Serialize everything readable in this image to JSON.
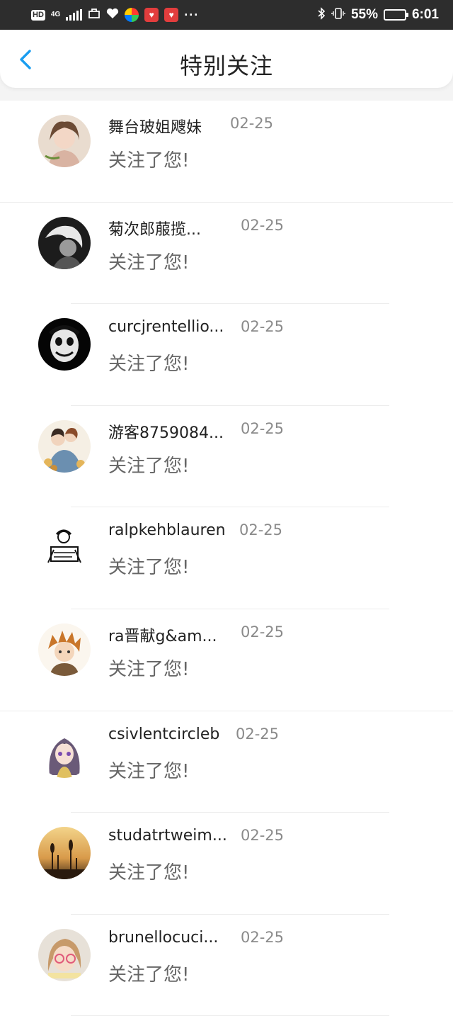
{
  "status_bar": {
    "hd_label": "HD",
    "network": "4G",
    "battery": "55%",
    "battery_level": 0.55,
    "time": "6:01",
    "more": "···",
    "icons": [
      "signal-icon",
      "bag-icon",
      "heart-icon",
      "multicolor-app-icon",
      "red-heart-app-icon",
      "red-heart-app-icon",
      "bluetooth-icon",
      "vibrate-icon",
      "battery-icon"
    ]
  },
  "header": {
    "title": "特别关注",
    "back_icon": "chevron-left-icon",
    "accent_color": "#1a9df0"
  },
  "notifications": [
    {
      "name": "舞台玻姐飕妹",
      "date": "02-25",
      "message": "关注了您!",
      "avatar": "avatar-girl-portrait"
    },
    {
      "name": "菊次郎菔揽...",
      "date": "02-25",
      "message": "关注了您!",
      "avatar": "avatar-bw-portrait"
    },
    {
      "name": "curcjrentellio...",
      "date": "02-25",
      "message": "关注了您!",
      "avatar": "avatar-clown-face"
    },
    {
      "name": "游客8759084...",
      "date": "02-25",
      "message": "关注了您!",
      "avatar": "avatar-couple-illustration"
    },
    {
      "name": "ralpkehblauren",
      "date": "02-25",
      "message": "关注了您!",
      "avatar": "avatar-sketch-logo"
    },
    {
      "name": "ra晋献g&am...",
      "date": "02-25",
      "message": "关注了您!",
      "avatar": "avatar-anime-boy"
    },
    {
      "name": "csivlentcircleb",
      "date": "02-25",
      "message": "关注了您!",
      "avatar": "avatar-anime-girl"
    },
    {
      "name": "studatrtweim...",
      "date": "02-25",
      "message": "关注了您!",
      "avatar": "avatar-sunset-plants"
    },
    {
      "name": "brunellocuci...",
      "date": "02-25",
      "message": "关注了您!",
      "avatar": "avatar-girl-glasses"
    }
  ]
}
